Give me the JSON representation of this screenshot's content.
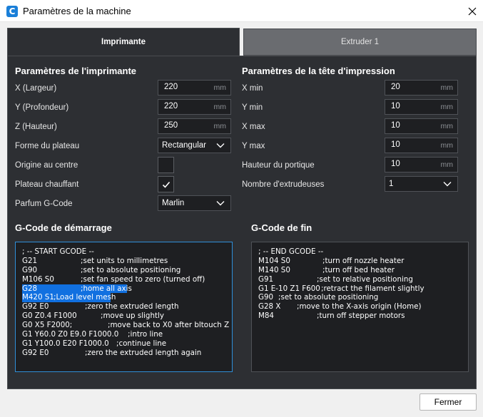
{
  "window": {
    "title": "Paramètres de la machine",
    "app_icon_letter": "C",
    "close_icon": "close-icon"
  },
  "tabs": [
    {
      "label": "Imprimante",
      "active": true
    },
    {
      "label": "Extruder 1",
      "active": false
    }
  ],
  "printer": {
    "section_title": "Paramètres de l'imprimante",
    "x_label": "X (Largeur)",
    "x_value": "220",
    "x_unit": "mm",
    "y_label": "Y (Profondeur)",
    "y_value": "220",
    "y_unit": "mm",
    "z_label": "Z (Hauteur)",
    "z_value": "250",
    "z_unit": "mm",
    "bed_shape_label": "Forme du plateau",
    "bed_shape_value": "Rectangular",
    "origin_center_label": "Origine au centre",
    "origin_center_checked": false,
    "heated_bed_label": "Plateau chauffant",
    "heated_bed_checked": true,
    "gcode_flavor_label": "Parfum G-Code",
    "gcode_flavor_value": "Marlin"
  },
  "printhead": {
    "section_title": "Paramètres de la tête d'impression",
    "xmin_label": "X min",
    "xmin_value": "20",
    "xmin_unit": "mm",
    "ymin_label": "Y min",
    "ymin_value": "10",
    "ymin_unit": "mm",
    "xmax_label": "X max",
    "xmax_value": "10",
    "xmax_unit": "mm",
    "ymax_label": "Y max",
    "ymax_value": "10",
    "ymax_unit": "mm",
    "gantry_label": "Hauteur du portique",
    "gantry_value": "10",
    "gantry_unit": "mm",
    "extruders_label": "Nombre d'extrudeuses",
    "extruders_value": "1"
  },
  "start_gcode": {
    "title": "G-Code de démarrage",
    "lines": [
      {
        "cmd": "; -- START GCODE --",
        "cmt": ""
      },
      {
        "cmd": "G21",
        "cmt": ";set units to millimetres"
      },
      {
        "cmd": "G90",
        "cmt": ";set to absolute positioning"
      },
      {
        "cmd": "M106 S0",
        "cmt": ";set fan speed to zero (turned off)"
      },
      {
        "cmd": "G28",
        "cmt": ";home all axis"
      },
      {
        "cmd": "M420 S1",
        "cmt": ";Load level mesh"
      },
      {
        "cmd": "G92 E0",
        "cmt": ";zero the extruded length"
      },
      {
        "cmd": "G0 Z0.4 F1000",
        "cmt": ";move up slightly"
      },
      {
        "cmd": "G0 X5 F2000;",
        "cmt": ";move back to X0 after bltouch Z"
      },
      {
        "cmd": "G1 Y60.0 Z0 E9.0 F1000.0",
        "cmt": ";intro line"
      },
      {
        "cmd": "G1 Y100.0 E20 F1000.0",
        "cmt": ";continue line"
      },
      {
        "cmd": "G92 E0",
        "cmt": ";zero the extruded length again"
      }
    ]
  },
  "end_gcode": {
    "title": "G-Code de fin",
    "lines": [
      {
        "cmd": "; -- END GCODE --",
        "cmt": ""
      },
      {
        "cmd": "M104 S0",
        "cmt": ";turn off nozzle heater"
      },
      {
        "cmd": "M140 S0",
        "cmt": ";turn off bed heater"
      },
      {
        "cmd": "G91",
        "cmt": ";set to relative positioning"
      },
      {
        "cmd": "G1 E-10 Z1 F600",
        "cmt": ";retract the filament slightly"
      },
      {
        "cmd": "G90",
        "cmt": ";set to absolute positioning"
      },
      {
        "cmd": "G28 X",
        "cmt": ";move to the X-axis origin (Home)"
      },
      {
        "cmd": "M84",
        "cmt": ";turn off stepper motors"
      }
    ]
  },
  "footer": {
    "close_label": "Fermer"
  },
  "colors": {
    "panel_bg": "#2d2f33",
    "field_bg": "#1e1f22",
    "selection": "#1170e0",
    "focus_border": "#2f8fd8"
  }
}
